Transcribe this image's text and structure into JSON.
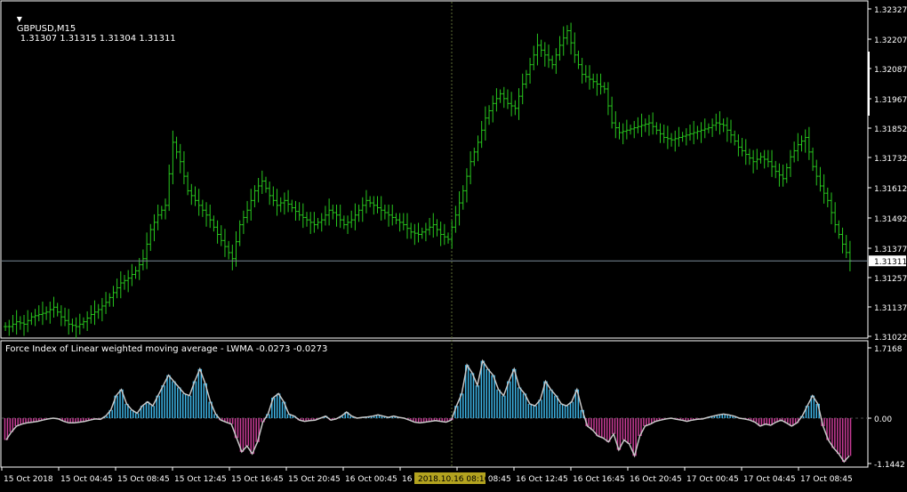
{
  "colors": {
    "background": "#000000",
    "frame": "#ffffff",
    "text": "#ffffff",
    "bar": "#28c81e",
    "price_line": "#7a8a98",
    "crosshair": "#5b6b35",
    "fi_positive": "#3db4e6",
    "fi_negative": "#c83c96",
    "fi_line": "#c8c8c8",
    "zero_line": "#4a4a4a",
    "date_highlight": "#b3a31f"
  },
  "symbol_menu_icon": "triangle-down-icon",
  "header": {
    "symbol": "GBPUSD,M15",
    "ohlc": "1.31307 1.31315 1.31304 1.31311"
  },
  "indicator": {
    "label": "Force Index of Linear weighted moving average - LWMA -0.0273 -0.0273"
  },
  "chart_data": [
    {
      "type": "ohlc",
      "title": "GBPUSD,M15",
      "ylim": [
        1.31,
        1.3235
      ],
      "y_ticks": [
        "1.32327",
        "1.32207",
        "1.32087",
        "1.31967",
        "1.31852",
        "1.31732",
        "1.31612",
        "1.31492",
        "1.31377",
        "1.31257",
        "1.31137",
        "1.31022"
      ],
      "current_price": "1.31311",
      "close_series": [
        1.3104,
        1.3106,
        1.3105,
        1.3108,
        1.3109,
        1.311,
        1.3112,
        1.3108,
        1.3105,
        1.3104,
        1.3106,
        1.3109,
        1.3111,
        1.3114,
        1.3118,
        1.3122,
        1.3124,
        1.3127,
        1.3132,
        1.3144,
        1.315,
        1.3154,
        1.318,
        1.3172,
        1.316,
        1.3156,
        1.3152,
        1.3148,
        1.3142,
        1.3137,
        1.3132,
        1.3146,
        1.3152,
        1.316,
        1.3164,
        1.3158,
        1.3154,
        1.3156,
        1.3153,
        1.315,
        1.3148,
        1.3146,
        1.3148,
        1.3152,
        1.315,
        1.3146,
        1.3148,
        1.3152,
        1.3156,
        1.3154,
        1.3152,
        1.315,
        1.3148,
        1.3146,
        1.3143,
        1.3142,
        1.3144,
        1.3146,
        1.3142,
        1.314,
        1.315,
        1.316,
        1.3172,
        1.318,
        1.319,
        1.3196,
        1.32,
        1.3196,
        1.3194,
        1.3204,
        1.3212,
        1.322,
        1.3216,
        1.3212,
        1.322,
        1.3226,
        1.3216,
        1.3208,
        1.3206,
        1.3204,
        1.3202,
        1.3188,
        1.3184,
        1.3185,
        1.3186,
        1.3187,
        1.3188,
        1.3185,
        1.3182,
        1.3181,
        1.3182,
        1.3183,
        1.3184,
        1.3185,
        1.3186,
        1.3188,
        1.3187,
        1.3183,
        1.3178,
        1.3175,
        1.3172,
        1.3174,
        1.3172,
        1.3168,
        1.3165,
        1.3174,
        1.3179,
        1.3182,
        1.317,
        1.3162,
        1.3156,
        1.3146,
        1.3138,
        1.31311
      ],
      "x_ticks": [
        "15 Oct 2018",
        "15 Oct 04:45",
        "15 Oct 08:45",
        "15 Oct 12:45",
        "15 Oct 16:45",
        "15 Oct 20:45",
        "16 Oct 00:45",
        "16 Oct 04:45",
        "16 Oct 08:45",
        "16 Oct 12:45",
        "16 Oct 16:45",
        "16 Oct 20:45",
        "17 Oct 00:45",
        "17 Oct 04:45",
        "17 Oct 08:45"
      ],
      "crosshair_time": "2018.10.16 08:16"
    },
    {
      "type": "area",
      "title": "Force Index of Linear weighted moving average - LWMA",
      "ylim": [
        -1.1442,
        1.7168
      ],
      "y_ticks": [
        "1.7168",
        "0.00",
        "-1.1442"
      ],
      "values": [
        -0.55,
        -0.35,
        -0.2,
        -0.15,
        -0.12,
        -0.1,
        -0.08,
        -0.05,
        -0.02,
        0.0,
        -0.02,
        -0.08,
        -0.12,
        -0.12,
        -0.1,
        -0.08,
        -0.05,
        -0.02,
        -0.03,
        0.05,
        0.2,
        0.55,
        0.7,
        0.35,
        0.2,
        0.12,
        0.3,
        0.4,
        0.3,
        0.55,
        0.8,
        1.05,
        0.9,
        0.75,
        0.6,
        0.55,
        0.9,
        1.2,
        0.85,
        0.4,
        0.1,
        -0.05,
        -0.1,
        -0.15,
        -0.5,
        -0.85,
        -0.7,
        -0.9,
        -0.6,
        -0.1,
        0.1,
        0.5,
        0.6,
        0.4,
        0.1,
        0.05,
        -0.05,
        -0.08,
        -0.06,
        -0.05,
        0.0,
        0.05,
        -0.05,
        -0.02,
        0.05,
        0.15,
        0.05,
        0.0,
        0.02,
        0.03,
        0.05,
        0.08,
        0.05,
        0.02,
        0.05,
        0.02,
        0.0,
        -0.05,
        -0.1,
        -0.12,
        -0.1,
        -0.08,
        -0.06,
        -0.08,
        -0.1,
        -0.05,
        0.3,
        0.6,
        1.3,
        1.1,
        0.8,
        1.4,
        1.2,
        1.05,
        0.7,
        0.55,
        0.9,
        1.2,
        0.75,
        0.6,
        0.35,
        0.3,
        0.45,
        0.9,
        0.7,
        0.55,
        0.35,
        0.3,
        0.4,
        0.7,
        0.2,
        -0.2,
        -0.3,
        -0.45,
        -0.5,
        -0.6,
        -0.4,
        -0.8,
        -0.55,
        -0.65,
        -0.95,
        -0.45,
        -0.2,
        -0.15,
        -0.08,
        -0.05,
        -0.02,
        0.0,
        -0.03,
        -0.05,
        -0.08,
        -0.05,
        -0.03,
        -0.02,
        0.02,
        0.05,
        0.08,
        0.1,
        0.08,
        0.05,
        0.0,
        -0.02,
        -0.05,
        -0.1,
        -0.2,
        -0.15,
        -0.18,
        -0.1,
        -0.05,
        -0.12,
        -0.2,
        -0.12,
        0.05,
        0.3,
        0.55,
        0.35,
        -0.2,
        -0.55,
        -0.75,
        -0.9,
        -1.1,
        -0.95
      ]
    }
  ]
}
